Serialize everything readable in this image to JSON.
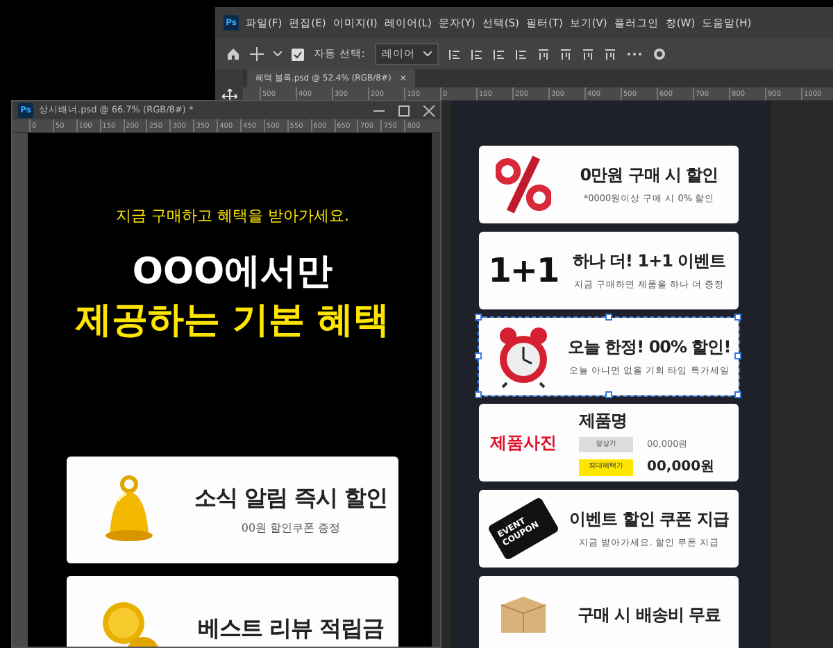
{
  "main_window": {
    "logo": "Ps",
    "menu": [
      "파일(F)",
      "편집(E)",
      "이미지(I)",
      "레이어(L)",
      "문자(Y)",
      "선택(S)",
      "필터(T)",
      "보기(V)",
      "플러그인",
      "창(W)",
      "도움말(H)"
    ],
    "options_bar": {
      "auto_select_label": "자동 선택:",
      "auto_select_checked": true,
      "target": "레이어"
    },
    "tab": {
      "title": "혜택 블록.psd @ 52.4% (RGB/8#)",
      "close": "×"
    },
    "ruler": [
      "500",
      "400",
      "300",
      "200",
      "100",
      "0",
      "100",
      "200",
      "300",
      "400",
      "500",
      "600",
      "700",
      "800",
      "900",
      "1000"
    ],
    "document": {
      "cards": [
        {
          "kind": "percent",
          "title": "0만원 구매 시 할인",
          "subtitle": "*0000원이상 구매 시 0% 할인",
          "selected": false
        },
        {
          "kind": "plusone",
          "graphic": "1+1",
          "title": "하나 더! 1+1 이벤트",
          "subtitle": "지금 구매하면 제품을 하나 더 증정",
          "selected": false
        },
        {
          "kind": "clock",
          "title": "오늘 한정! 00% 할인!",
          "subtitle": "오늘 아니면 없을 기회 타임 특가세일",
          "selected": true
        },
        {
          "kind": "product",
          "photo_label": "제품사진",
          "title": "제품명",
          "prices": [
            {
              "kind": "regular",
              "label": "정상가",
              "value": "00,000원"
            },
            {
              "kind": "best",
              "label": "최대혜택가",
              "value": "00,000원"
            }
          ],
          "selected": false
        },
        {
          "kind": "coupon",
          "graphic": "EVENT COUPON",
          "title": "이벤트 할인 쿠폰 지급",
          "subtitle": "지금 받아가세요. 할인 쿠폰 지급",
          "selected": false
        },
        {
          "kind": "parcel",
          "title": "구매 시 배송비 무료",
          "selected": false
        }
      ]
    }
  },
  "floating_window": {
    "logo": "Ps",
    "title": "상시배너.psd @ 66.7% (RGB/8#) *",
    "ruler": [
      "0",
      "50",
      "100",
      "150",
      "200",
      "250",
      "300",
      "350",
      "400",
      "450",
      "500",
      "550",
      "600",
      "650",
      "700",
      "750",
      "800"
    ],
    "document": {
      "subtitle": "지금 구매하고 혜택을 받아가세요.",
      "headline": [
        {
          "text": "OOO에서만",
          "color": "#ffffff"
        },
        {
          "text": "제공하는 기본 혜택",
          "color": "#ffe600"
        }
      ],
      "cards": [
        {
          "kind": "bell",
          "title": "소식 알림 즉시 할인",
          "subtitle": "00원 할인쿠폰 증정",
          "selected": false
        },
        {
          "kind": "coin",
          "title": "베스트 리뷰 적립금",
          "selected": false
        }
      ]
    }
  }
}
